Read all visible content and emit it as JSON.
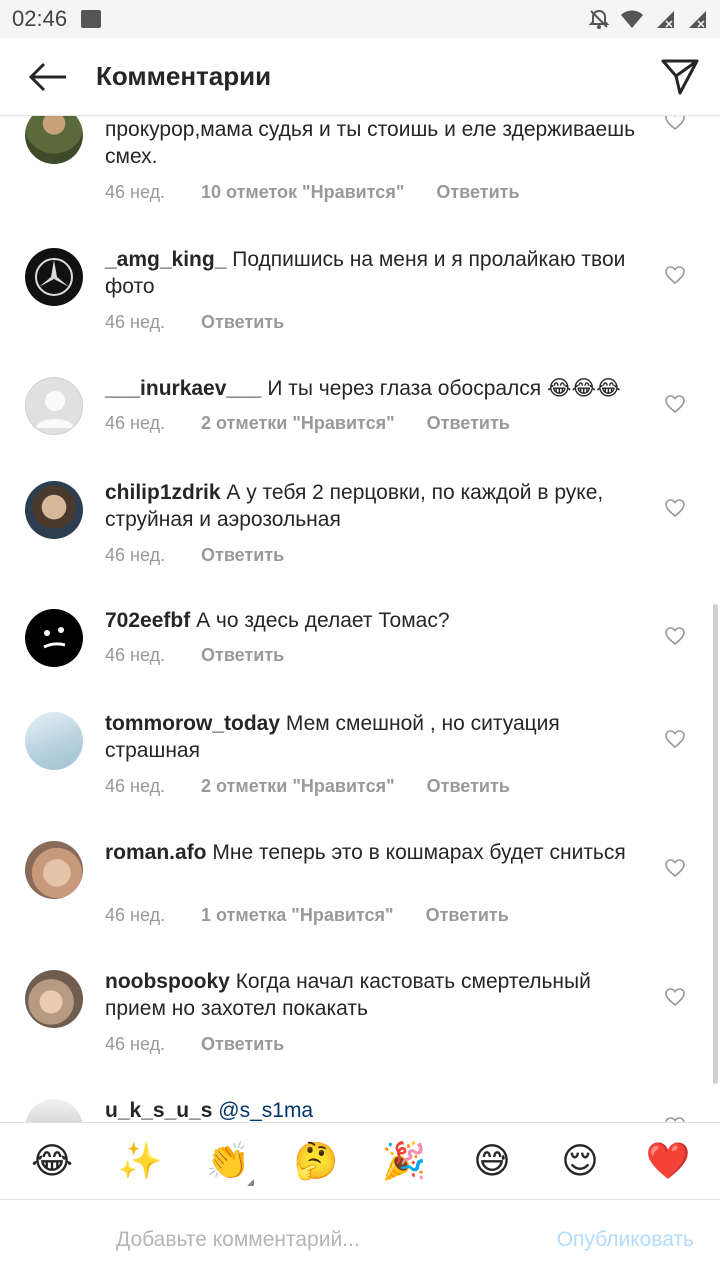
{
  "status_bar": {
    "time": "02:46",
    "icons": [
      "gallery-icon",
      "mute-icon",
      "wifi-icon",
      "signal-icon",
      "signal-icon"
    ]
  },
  "header": {
    "title": "Комментарии",
    "back_icon": "arrow-left-icon",
    "send_icon": "paper-plane-icon"
  },
  "comments": [
    {
      "username": "",
      "text": "прокурор,мама судья и ты стоишь и еле здерживаешь смех.",
      "time": "46 нед.",
      "likes": "10 отметок \"Нравится\"",
      "reply": "Ответить",
      "avatar": "soldier-avatar"
    },
    {
      "username": "_amg_king_",
      "text": "Подпишись на меня и я пролайкаю твои фото",
      "time": "46 нед.",
      "likes": "",
      "reply": "Ответить",
      "avatar": "mercedes-logo-avatar"
    },
    {
      "username": "___inurkaev___",
      "text": "И ты через глаза обосрался 😂😂😂",
      "time": "46 нед.",
      "likes": "2 отметки \"Нравится\"",
      "reply": "Ответить",
      "avatar": "default-avatar"
    },
    {
      "username": "chilip1zdrik",
      "text": "А у тебя 2 перцовки, по каждой в руке, струйная и аэрозольная",
      "time": "46 нед.",
      "likes": "",
      "reply": "Ответить",
      "avatar": "photo-avatar"
    },
    {
      "username": "702eefbf",
      "text": "А чо здесь делает Томас?",
      "time": "46 нед.",
      "likes": "",
      "reply": "Ответить",
      "avatar": "face-avatar"
    },
    {
      "username": "tommorow_today",
      "text": "Мем смешной , но ситуация страшная",
      "time": "46 нед.",
      "likes": "2 отметки \"Нравится\"",
      "reply": "Ответить",
      "avatar": "sky-avatar"
    },
    {
      "username": "roman.afo",
      "text": "Мне теперь это в кошмарах будет сниться",
      "time": "46 нед.",
      "likes": "1 отметка \"Нравится\"",
      "reply": "Ответить",
      "avatar": "photo-avatar"
    },
    {
      "username": "noobspooky",
      "text": "Когда начал кастовать смертельный прием но захотел покакать",
      "time": "46 нед.",
      "likes": "",
      "reply": "Ответить",
      "avatar": "photo-avatar"
    },
    {
      "username": "u_k_s_u_s",
      "text": "@s_s1ma",
      "time": "",
      "likes": "",
      "reply": "",
      "avatar": "photo-avatar"
    }
  ],
  "emoji_bar": [
    "😂",
    "✨",
    "👏",
    "🤔",
    "🎉",
    "😅",
    "😌",
    "❤️"
  ],
  "input": {
    "placeholder": "Добавьте комментарий...",
    "publish_label": "Опубликовать"
  },
  "colors": {
    "text": "#262626",
    "meta": "#999999",
    "publish_disabled": "#b3dbff",
    "mention": "#003569"
  }
}
